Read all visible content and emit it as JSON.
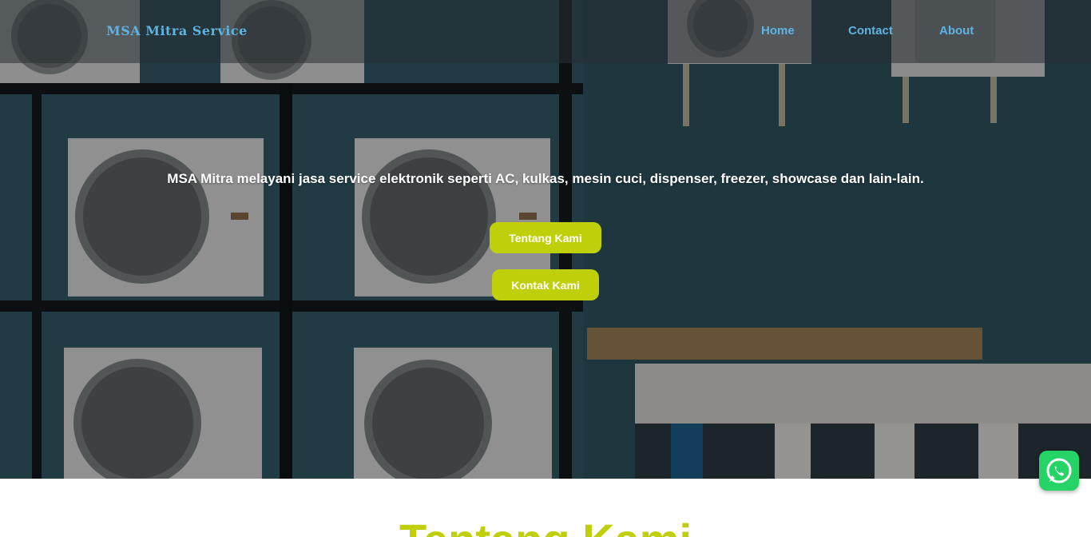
{
  "navbar": {
    "brand": "MSA Mitra Service",
    "links": [
      {
        "label": "Home"
      },
      {
        "label": "Contact"
      },
      {
        "label": "About"
      }
    ]
  },
  "hero": {
    "tagline": "MSA Mitra melayani jasa service elektronik seperti AC, kulkas, mesin cuci, dispenser, freezer, showcase dan lain-lain.",
    "buttons": {
      "about": "Tentang Kami",
      "contact": "Kontak Kami"
    },
    "background": "photo of outdoor air conditioner units mounted on a metal rack and wall"
  },
  "section": {
    "title": "Tentang Kami"
  },
  "whatsapp": {
    "icon": "whatsapp-icon"
  },
  "colors": {
    "accent": "#bfcf09",
    "nav_link": "#5fb3e0",
    "whatsapp": "#25d366"
  }
}
